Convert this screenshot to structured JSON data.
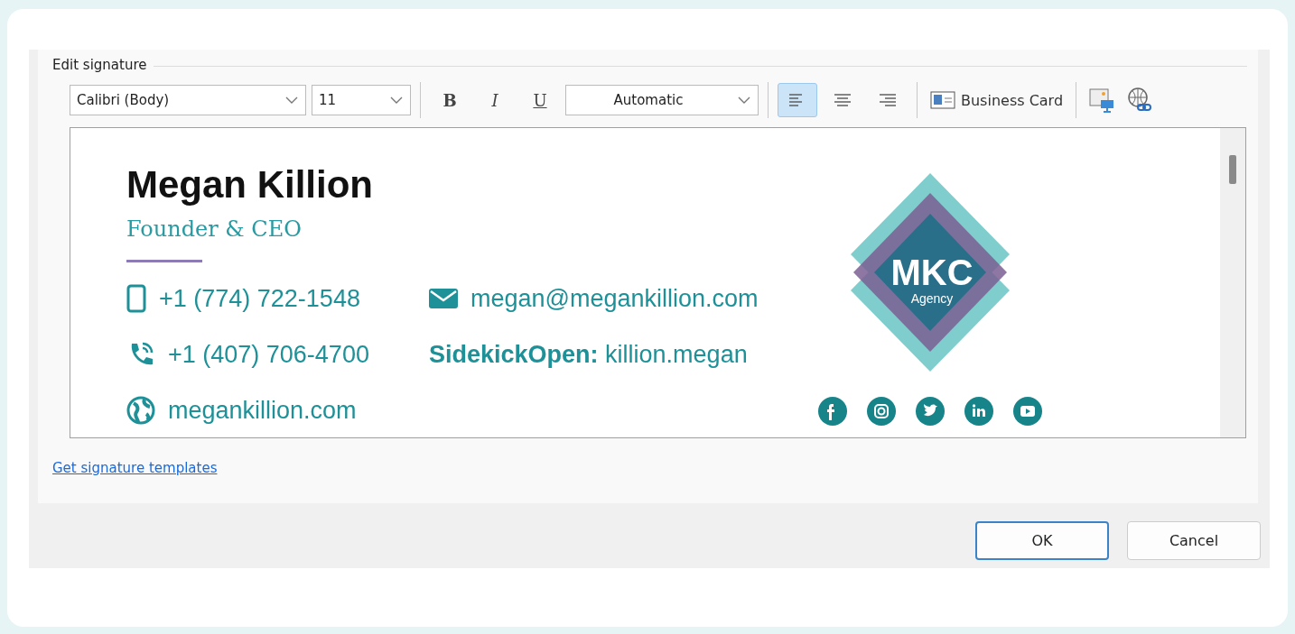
{
  "dialog": {
    "section_label": "Edit signature",
    "toolbar": {
      "font": "Calibri (Body)",
      "size": "11",
      "bold": "B",
      "italic": "I",
      "underline": "U",
      "color_label": "Automatic",
      "alignments": [
        {
          "kind": "left",
          "selected": true
        },
        {
          "kind": "center",
          "selected": false
        },
        {
          "kind": "right",
          "selected": false
        }
      ],
      "business_card": "Business Card"
    },
    "signature": {
      "name": "Megan Killion",
      "title": "Founder & CEO",
      "contacts": [
        {
          "kind": "mobile",
          "text": "+1 (774) 722-1548"
        },
        {
          "kind": "email",
          "text": "megan@megankillion.com"
        },
        {
          "kind": "phone",
          "text": "+1 (407) 706-4700"
        },
        {
          "kind": "sidekick",
          "text": "**SidekickOpen:** killion.megan"
        },
        {
          "kind": "web",
          "text": "megankillion.com"
        }
      ],
      "logo": {
        "title": "MKC",
        "subtitle": "Agency"
      },
      "social": [
        {
          "kind": "facebook"
        },
        {
          "kind": "instagram"
        },
        {
          "kind": "twitter"
        },
        {
          "kind": "linkedin"
        },
        {
          "kind": "youtube"
        }
      ]
    },
    "templates_link": "Get signature templates",
    "buttons": [
      {
        "label": "OK",
        "default": true
      },
      {
        "label": "Cancel",
        "default": false
      }
    ]
  }
}
